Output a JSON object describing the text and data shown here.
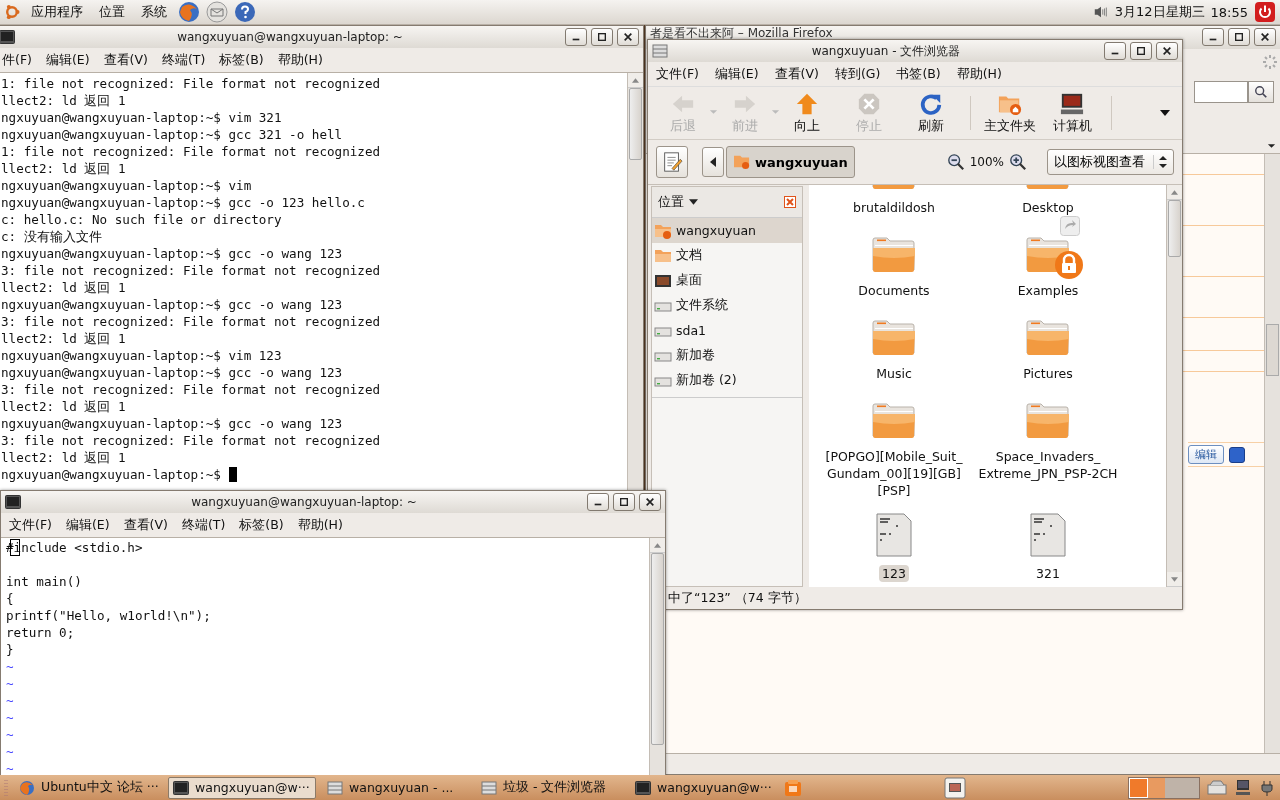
{
  "top_panel": {
    "menus": [
      "应用程序",
      "位置",
      "系统"
    ],
    "date": "3月12日星期三",
    "time": "18:55"
  },
  "background_window": {
    "title": "者是看不出来阿 – Mozilla Firefox",
    "edit_button": "编辑"
  },
  "terminal_1": {
    "title": "wangxuyuan@wangxuyuan-laptop: ~",
    "menus": [
      "件(F)",
      "编辑(E)",
      "查看(V)",
      "终端(T)",
      "标签(B)",
      "帮助(H)"
    ],
    "lines": [
      {
        "text": "1: file not recognized: File format not recognized",
        "cursor": false
      },
      {
        "text": "llect2: ld 返回 1",
        "cursor": false
      },
      {
        "text": "ngxuyuan@wangxuyuan-laptop:~$ vim 321",
        "cursor": false
      },
      {
        "text": "ngxuyuan@wangxuyuan-laptop:~$ gcc 321 -o hell",
        "cursor": false
      },
      {
        "text": "1: file not recognized: File format not recognized",
        "cursor": false
      },
      {
        "text": "llect2: ld 返回 1",
        "cursor": false
      },
      {
        "text": "ngxuyuan@wangxuyuan-laptop:~$ vim",
        "cursor": false
      },
      {
        "text": "ngxuyuan@wangxuyuan-laptop:~$ gcc -o 123 hello.c",
        "cursor": false
      },
      {
        "text": "c: hello.c: No such file or directory",
        "cursor": false
      },
      {
        "text": "c: 没有输入文件",
        "cursor": false
      },
      {
        "text": "ngxuyuan@wangxuyuan-laptop:~$ gcc -o wang 123",
        "cursor": false
      },
      {
        "text": "3: file not recognized: File format not recognized",
        "cursor": false
      },
      {
        "text": "llect2: ld 返回 1",
        "cursor": false
      },
      {
        "text": "ngxuyuan@wangxuyuan-laptop:~$ gcc -o wang 123",
        "cursor": false
      },
      {
        "text": "3: file not recognized: File format not recognized",
        "cursor": false
      },
      {
        "text": "llect2: ld 返回 1",
        "cursor": false
      },
      {
        "text": "ngxuyuan@wangxuyuan-laptop:~$ vim 123",
        "cursor": false
      },
      {
        "text": "ngxuyuan@wangxuyuan-laptop:~$ gcc -o wang 123",
        "cursor": false
      },
      {
        "text": "3: file not recognized: File format not recognized",
        "cursor": false
      },
      {
        "text": "llect2: ld 返回 1",
        "cursor": false
      },
      {
        "text": "ngxuyuan@wangxuyuan-laptop:~$ gcc -o wang 123",
        "cursor": false
      },
      {
        "text": "3: file not recognized: File format not recognized",
        "cursor": false
      },
      {
        "text": "llect2: ld 返回 1",
        "cursor": false
      },
      {
        "text": "ngxuyuan@wangxuyuan-laptop:~$",
        "cursor": true
      }
    ]
  },
  "file_browser": {
    "title": "wangxuyuan - 文件浏览器",
    "menus": [
      "文件(F)",
      "编辑(E)",
      "查看(V)",
      "转到(G)",
      "书签(B)",
      "帮助(H)"
    ],
    "toolbar": {
      "navigation": [
        {
          "label": "后退",
          "kind": "back",
          "disabled": true,
          "has_menu": true
        },
        {
          "label": "前进",
          "kind": "forward",
          "disabled": true,
          "has_menu": true
        },
        {
          "label": "向上",
          "kind": "up",
          "disabled": false,
          "has_menu": false
        },
        {
          "label": "停止",
          "kind": "stop",
          "disabled": true,
          "has_menu": false
        },
        {
          "label": "刷新",
          "kind": "reload",
          "disabled": false,
          "has_menu": false
        }
      ],
      "places": [
        {
          "label": "主文件夹",
          "kind": "home",
          "disabled": false,
          "has_menu": false
        },
        {
          "label": "计算机",
          "kind": "computer",
          "disabled": false,
          "has_menu": false
        }
      ]
    },
    "location": "wangxuyuan",
    "zoom": "100%",
    "view_mode": "以图标视图查看",
    "sidebar": {
      "title": "位置",
      "items": [
        {
          "label": "wangxuyuan",
          "kind": "home",
          "selected": true
        },
        {
          "label": "文档",
          "kind": "folder",
          "selected": false
        },
        {
          "label": "桌面",
          "kind": "desktop",
          "selected": false
        },
        {
          "label": "文件系统",
          "kind": "drive",
          "selected": false
        },
        {
          "label": "sda1",
          "kind": "drive",
          "selected": false
        },
        {
          "label": "新加卷",
          "kind": "drive",
          "selected": false
        },
        {
          "label": "新加卷 (2)",
          "kind": "drive",
          "selected": false
        }
      ]
    },
    "files": [
      {
        "name": "brutaldildosh",
        "kind": "folder",
        "selected": false,
        "locked": false
      },
      {
        "name": "Desktop",
        "kind": "folder",
        "selected": false,
        "locked": false
      },
      {
        "name": "Documents",
        "kind": "folder",
        "selected": false,
        "locked": false
      },
      {
        "name": "Examples",
        "kind": "folder",
        "selected": false,
        "locked": true
      },
      {
        "name": "Music",
        "kind": "folder",
        "selected": false,
        "locked": false
      },
      {
        "name": "Pictures",
        "kind": "folder",
        "selected": false,
        "locked": false
      },
      {
        "name": "[POPGO][Mobile_Suit_ Gundam_00][19][GB] [PSP]",
        "kind": "folder",
        "selected": false,
        "locked": false
      },
      {
        "name": "Space_Invaders_ Extreme_JPN_PSP-2CH",
        "kind": "folder",
        "selected": false,
        "locked": false
      },
      {
        "name": "123",
        "kind": "text",
        "selected": true,
        "locked": false
      },
      {
        "name": "321",
        "kind": "text",
        "selected": false,
        "locked": false
      }
    ],
    "status": "中了“123” （74 字节）"
  },
  "terminal_2": {
    "title": "wangxuyuan@wangxuyuan-laptop: ~",
    "menus": [
      "文件(F)",
      "编辑(E)",
      "查看(V)",
      "终端(T)",
      "标签(B)",
      "帮助(H)"
    ],
    "lines": [
      {
        "kind": "code",
        "text": "#include <stdio.h>",
        "cursor": true
      },
      {
        "kind": "blank",
        "cursor": false
      },
      {
        "kind": "code",
        "text": "int main()",
        "cursor": false
      },
      {
        "kind": "code",
        "text": "{",
        "cursor": false
      },
      {
        "kind": "code",
        "text": "printf(\"Hello, w1orld!\\n\");",
        "cursor": false
      },
      {
        "kind": "code",
        "text": "return 0;",
        "cursor": false
      },
      {
        "kind": "code",
        "text": "}",
        "cursor": false
      },
      {
        "kind": "filler",
        "text": "~",
        "cursor": false
      },
      {
        "kind": "filler",
        "text": "~",
        "cursor": false
      },
      {
        "kind": "filler",
        "text": "~",
        "cursor": false
      },
      {
        "kind": "filler",
        "text": "~",
        "cursor": false
      },
      {
        "kind": "filler",
        "text": "~",
        "cursor": false
      },
      {
        "kind": "filler",
        "text": "~",
        "cursor": false
      },
      {
        "kind": "filler",
        "text": "~",
        "cursor": false
      }
    ]
  },
  "taskbar": [
    {
      "label": "Ubuntu中文 论坛 ···",
      "kind": "browser",
      "selected": false
    },
    {
      "label": "wangxuyuan@w···",
      "kind": "terminal",
      "selected": true
    },
    {
      "label": "wangxuyuan - ...",
      "kind": "files",
      "selected": false
    },
    {
      "label": "垃圾 - 文件浏览器",
      "kind": "files",
      "selected": false
    },
    {
      "label": "wangxuyuan@w···",
      "kind": "terminal",
      "selected": false
    }
  ]
}
